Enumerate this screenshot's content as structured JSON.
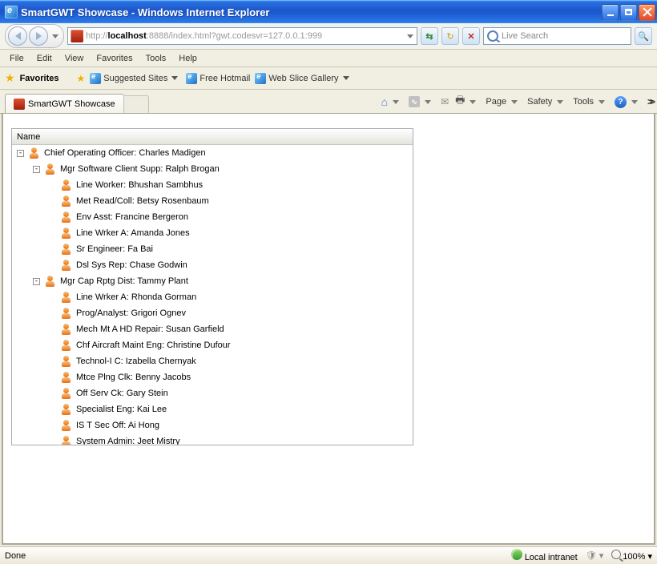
{
  "window": {
    "title": "SmartGWT Showcase - Windows Internet Explorer"
  },
  "address": {
    "protocol": "http://",
    "host": "localhost",
    "rest": ":8888/index.html?gwt.codesvr=127.0.0.1:999"
  },
  "search": {
    "placeholder": "Live Search"
  },
  "menu": {
    "file": "File",
    "edit": "Edit",
    "view": "View",
    "favorites": "Favorites",
    "tools": "Tools",
    "help": "Help"
  },
  "favbar": {
    "label": "Favorites",
    "suggested": "Suggested Sites",
    "hotmail": "Free Hotmail",
    "webslice": "Web Slice Gallery"
  },
  "tab": {
    "title": "SmartGWT Showcase"
  },
  "cmd": {
    "page": "Page",
    "safety": "Safety",
    "tools": "Tools"
  },
  "tree": {
    "header": "Name",
    "root": {
      "label": "Chief Operating Officer: Charles Madigen",
      "children": [
        {
          "label": "Mgr Software Client Supp: Ralph Brogan",
          "children": [
            {
              "label": "Line Worker: Bhushan Sambhus"
            },
            {
              "label": "Met Read/Coll: Betsy Rosenbaum"
            },
            {
              "label": "Env Asst: Francine Bergeron"
            },
            {
              "label": "Line Wrker A: Amanda Jones"
            },
            {
              "label": "Sr Engineer: Fa Bai"
            },
            {
              "label": "Dsl Sys Rep: Chase Godwin"
            }
          ]
        },
        {
          "label": "Mgr Cap Rptg Dist: Tammy Plant",
          "children": [
            {
              "label": "Line Wrker A: Rhonda Gorman"
            },
            {
              "label": "Prog/Analyst: Grigori Ognev"
            },
            {
              "label": "Mech Mt A HD Repair: Susan Garfield"
            },
            {
              "label": "Chf Aircraft Maint Eng: Christine Dufour"
            },
            {
              "label": "Technol-I C: Izabella Chernyak"
            },
            {
              "label": "Mtce Plng Clk: Benny Jacobs"
            },
            {
              "label": "Off Serv Ck: Gary Stein"
            },
            {
              "label": "Specialist Eng: Kai Lee"
            },
            {
              "label": "IS T Sec Off: Ai Hong"
            },
            {
              "label": "System Admin: Jeet Mistry"
            }
          ]
        }
      ]
    }
  },
  "status": {
    "left": "Done",
    "zone": "Local intranet",
    "zoom": "100%"
  }
}
